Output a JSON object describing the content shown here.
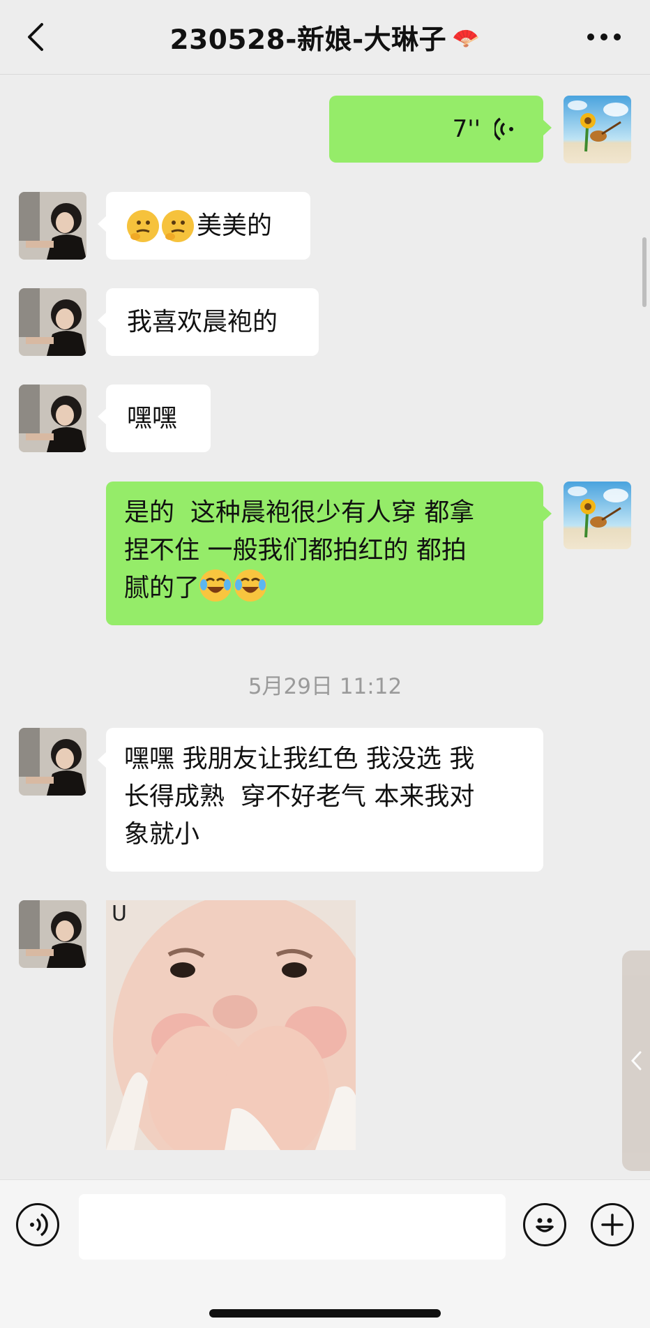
{
  "header": {
    "title": "230528-新娘-大琳子",
    "title_decoration": "🪭"
  },
  "messages": [
    {
      "from": "me",
      "type": "voice",
      "duration": "7''"
    },
    {
      "from": "friend",
      "type": "text",
      "text": "美美的",
      "emoji_prefix": [
        "thinking-face",
        "thinking-face"
      ]
    },
    {
      "from": "friend",
      "type": "text",
      "text": "我喜欢晨袍的"
    },
    {
      "from": "friend",
      "type": "text",
      "text": "嘿嘿"
    },
    {
      "from": "me",
      "type": "text",
      "lines": [
        "是的  这种晨袍很少有人穿 都拿",
        "捏不住 一般我们都拍红的 都拍",
        "腻的了"
      ],
      "emoji_suffix": [
        "tears-of-joy-face",
        "tears-of-joy-face"
      ]
    },
    {
      "type": "timestamp",
      "text": "5月29日 11:12"
    },
    {
      "from": "friend",
      "type": "text",
      "lines": [
        "嘿嘿 我朋友让我红色 我没选 我",
        "长得成熟  穿不好老气 本来我对",
        "象就小"
      ]
    },
    {
      "from": "friend",
      "type": "sticker",
      "sticker_glyph": "U",
      "description_icon": "baby-sticker"
    }
  ],
  "input": {
    "placeholder": "",
    "value": ""
  },
  "colors": {
    "background": "#ededed",
    "bubble_me": "#95ec69",
    "bubble_friend": "#ffffff",
    "timestamp": "#9a9a9a"
  }
}
